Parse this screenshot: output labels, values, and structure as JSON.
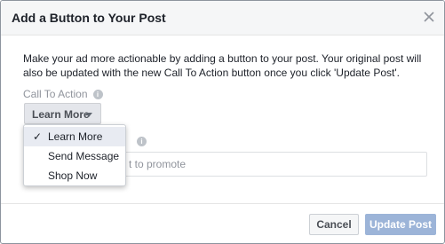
{
  "dialog": {
    "title": "Add a Button to Your Post",
    "description": "Make your ad more actionable by adding a button to your post. Your original post will also be updated with the new Call To Action button once you click 'Update Post'.",
    "cta_label": "Call To Action",
    "selected_cta": "Learn More",
    "menu_items": [
      {
        "label": "Learn More",
        "selected": true
      },
      {
        "label": "Send Message",
        "selected": false
      },
      {
        "label": "Shop Now",
        "selected": false
      }
    ],
    "input_placeholder": "t to promote",
    "cancel_label": "Cancel",
    "update_label": "Update Post"
  },
  "icons": {
    "close": "close-icon",
    "info": "info-icon",
    "caret": "caret-down-icon",
    "check": "checkmark-icon"
  },
  "colors": {
    "header_bg": "#f5f6f7",
    "update_button_disabled": "#9cb4d8",
    "menu_selected_bg": "#e8ebf2"
  }
}
